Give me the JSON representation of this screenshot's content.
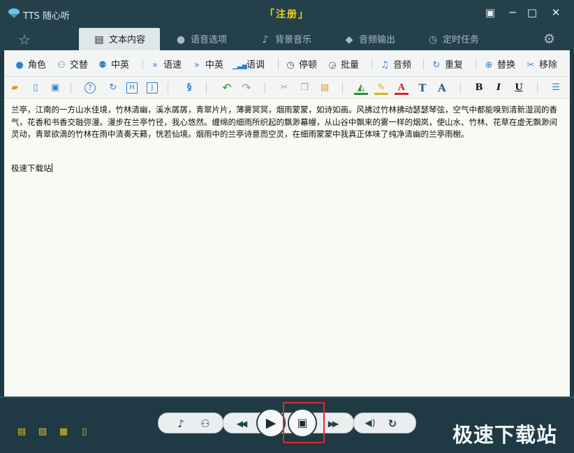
{
  "window": {
    "title": "TTS 随心听",
    "register_label": "「注册」",
    "controls": [
      "▣",
      "─",
      "□",
      "✕"
    ]
  },
  "tabs": [
    {
      "label": "文本内容",
      "icon": "document-icon",
      "glyph": "▤"
    },
    {
      "label": "语音选项",
      "icon": "speech-bubble-icon",
      "glyph": "●"
    },
    {
      "label": "背景音乐",
      "icon": "music-note-icon",
      "glyph": "♪"
    },
    {
      "label": "音频输出",
      "icon": "audio-output-icon",
      "glyph": "◆"
    },
    {
      "label": "定时任务",
      "icon": "timer-icon",
      "glyph": "◷"
    }
  ],
  "toolbar1": [
    {
      "label": "角色",
      "icon": "person-icon",
      "glyph": "👤"
    },
    {
      "label": "交替",
      "icon": "alternate-person-icon",
      "glyph": "⚇"
    },
    {
      "label": "中英",
      "icon": "chinese-english-person-icon",
      "glyph": "⚉"
    },
    {
      "label": "语速",
      "icon": "speed-icon",
      "glyph": "»"
    },
    {
      "label": "中英",
      "icon": "chinese-english-speed-icon",
      "glyph": "»"
    },
    {
      "label": "语调",
      "icon": "tone-bars-icon",
      "glyph": "▁▃▅"
    },
    {
      "label": "停顿",
      "icon": "pause-clock-icon",
      "glyph": "◷"
    },
    {
      "label": "批量",
      "icon": "batch-clock-icon",
      "glyph": "◶"
    },
    {
      "label": "音频",
      "icon": "audio-note-icon",
      "glyph": "♫"
    },
    {
      "label": "重复",
      "icon": "repeat-icon",
      "glyph": "↻"
    },
    {
      "label": "替换",
      "icon": "replace-target-icon",
      "glyph": "⊕"
    },
    {
      "label": "移除",
      "icon": "remove-icon",
      "glyph": "✂"
    }
  ],
  "toolbar2": [
    {
      "icon": "open-folder-icon",
      "glyph": "📂",
      "color": "#d79b1d"
    },
    {
      "icon": "new-document-icon",
      "glyph": "▯",
      "color": "#3c7fc2"
    },
    {
      "icon": "save-disk-icon",
      "glyph": "▣",
      "color": "#3c7fc2"
    },
    {
      "icon": "help-icon",
      "glyph": "?",
      "color": "#2f7fd1"
    },
    {
      "icon": "refresh-icon",
      "glyph": "↻",
      "color": "#2f7fd1"
    },
    {
      "icon": "h-box-icon",
      "glyph": "H",
      "color": "#2f7fd1"
    },
    {
      "icon": "j-box-icon",
      "glyph": "J",
      "color": "#2f7fd1"
    },
    {
      "icon": "link-icon",
      "glyph": "§",
      "color": "#2f7fd1"
    },
    {
      "icon": "undo-icon",
      "glyph": "↶",
      "color": "#2e9a3c"
    },
    {
      "icon": "redo-icon",
      "glyph": "↷",
      "color": "#9aa2a4"
    },
    {
      "icon": "cut-icon",
      "glyph": "✂",
      "color": "#9aa2a4"
    },
    {
      "icon": "copy-icon",
      "glyph": "❐",
      "color": "#9aa2a4"
    },
    {
      "icon": "paste-icon",
      "glyph": "📋",
      "color": "#d79b1d"
    },
    {
      "icon": "fill-color-icon",
      "glyph": "◭",
      "color": "#2e8a3c"
    },
    {
      "icon": "highlight-pen-icon",
      "glyph": "✎",
      "color": "#d8b418"
    },
    {
      "icon": "font-color-icon",
      "glyph": "A",
      "color": "#d32727"
    },
    {
      "icon": "text-size-t-icon",
      "glyph": "T",
      "color": "#2c5f86"
    },
    {
      "icon": "text-size-a-icon",
      "glyph": "A",
      "color": "#2c5f86"
    },
    {
      "icon": "bold-icon",
      "glyph": "B",
      "color": "#111111"
    },
    {
      "icon": "italic-icon",
      "glyph": "I",
      "color": "#111111"
    },
    {
      "icon": "underline-icon",
      "glyph": "U",
      "color": "#111111"
    },
    {
      "icon": "panel-toggle-icon",
      "glyph": "☰",
      "color": "#2f7fd1"
    }
  ],
  "editor": {
    "paragraph1": "兰亭，江南的一方山水佳境，竹林清幽，溪水孱孱，青翠片片，薄雾冥冥，烟雨蒙蒙，如诗如画。风拂过竹林拂动瑟瑟琴弦，空气中都能嗅到清新湿润的香气，花香和书香交融弥漫。漫步在兰亭竹径，我心悠然。缠绵的细雨所织起的飘渺幕幔，从山谷中飘来的雾一样的烟岚，使山水、竹林、花草在虚无飘渺间灵动，青翠欲滴的竹林在雨中清奏天籁，恍若仙境。烟雨中的兰亭诗意而空灵，在细雨蒙蒙中我真正体味了纯净清幽的兰亭雨榭。",
    "paragraph2": "极速下载站"
  },
  "playback": {
    "controls": [
      {
        "icon": "read-aloud-icon",
        "glyph": "♪"
      },
      {
        "icon": "voice-person-icon",
        "glyph": "⚇"
      },
      {
        "icon": "rewind-icon",
        "glyph": "◀◀"
      },
      {
        "icon": "play-icon",
        "glyph": "▶"
      },
      {
        "icon": "save-audio-icon",
        "glyph": "▣"
      },
      {
        "icon": "fast-forward-icon",
        "glyph": "▶▶"
      },
      {
        "icon": "volume-icon",
        "glyph": "◀)"
      },
      {
        "icon": "loop-icon",
        "glyph": "↻"
      }
    ],
    "left_icons": [
      {
        "icon": "output-device-icon",
        "glyph": "▤"
      },
      {
        "icon": "clipboard-icon",
        "glyph": "▧"
      },
      {
        "icon": "keyboard-icon",
        "glyph": "▦"
      },
      {
        "icon": "book-icon",
        "glyph": "▯"
      }
    ]
  },
  "watermark": "极速下载站",
  "colors": {
    "titlebar": "#24414b",
    "accent_yellow": "#f5d21c",
    "highlight_box": "#e12a2a",
    "editor_bg": "#f7fbf4"
  }
}
